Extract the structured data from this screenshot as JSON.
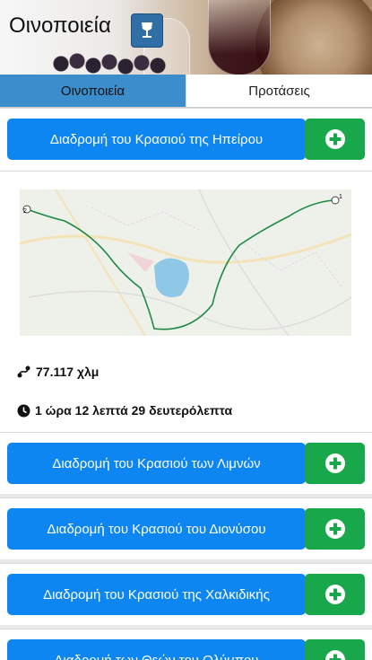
{
  "header": {
    "title": "Οινοποιεία"
  },
  "tabs": [
    {
      "label": "Οινοποιεία",
      "active": true
    },
    {
      "label": "Προτάσεις",
      "active": false
    }
  ],
  "routes": [
    {
      "label": "Διαδρομή του Κρασιού της Ηπείρου"
    },
    {
      "label": "Διαδρομή του Κρασιού των Λιμνών"
    },
    {
      "label": "Διαδρομή του Κρασιού του Διονύσου"
    },
    {
      "label": "Διαδρομή του Κρασιού της Χαλκιδικής"
    },
    {
      "label": "Διαδρομή των Θεών του Ολύμπου"
    }
  ],
  "details": {
    "distance": "77.117 χλμ",
    "duration": "1 ώρα 12 λεπτά 29 δευτερόλεπτα",
    "map_markers": [
      "2",
      "1"
    ]
  },
  "colors": {
    "primary": "#0d86f2",
    "success": "#18a74a",
    "tab_active": "#3c8dcc"
  }
}
